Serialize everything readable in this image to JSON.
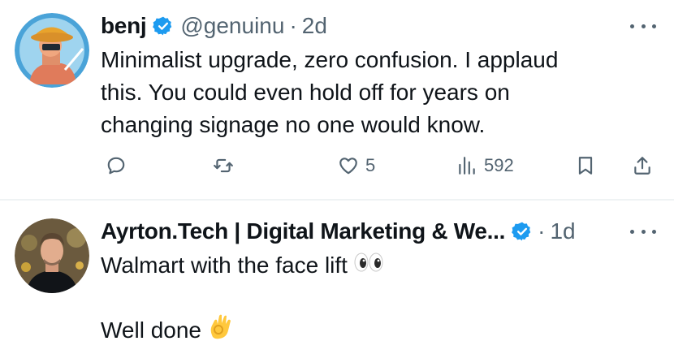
{
  "tweets": [
    {
      "author": {
        "name": "benj",
        "handle": "@genuinu",
        "verified": true
      },
      "time": "2d",
      "separator": "·",
      "text_lines": [
        "Minimalist upgrade, zero confusion. I applaud",
        "this. You could even hold off for years on",
        "changing signage no one would know."
      ],
      "actions": {
        "reply": {
          "icon": "reply-icon"
        },
        "retweet": {
          "icon": "retweet-icon"
        },
        "like": {
          "icon": "heart-icon",
          "count": "5"
        },
        "views": {
          "icon": "views-icon",
          "count": "592"
        },
        "bookmark": {
          "icon": "bookmark-icon"
        },
        "share": {
          "icon": "share-icon"
        }
      }
    },
    {
      "author": {
        "name": "Ayrton.Tech | Digital Marketing & We...",
        "verified": true
      },
      "time": "1d",
      "separator": "·",
      "text_line1": "Walmart with the face lift",
      "text_line1_emoji": "eyes",
      "text_line2": "Well done",
      "text_line2_emoji": "ok-hand"
    }
  ],
  "colors": {
    "text": "#0f1419",
    "secondary": "#536471",
    "verified": "#1d9bf0",
    "divider": "#eff3f4"
  }
}
